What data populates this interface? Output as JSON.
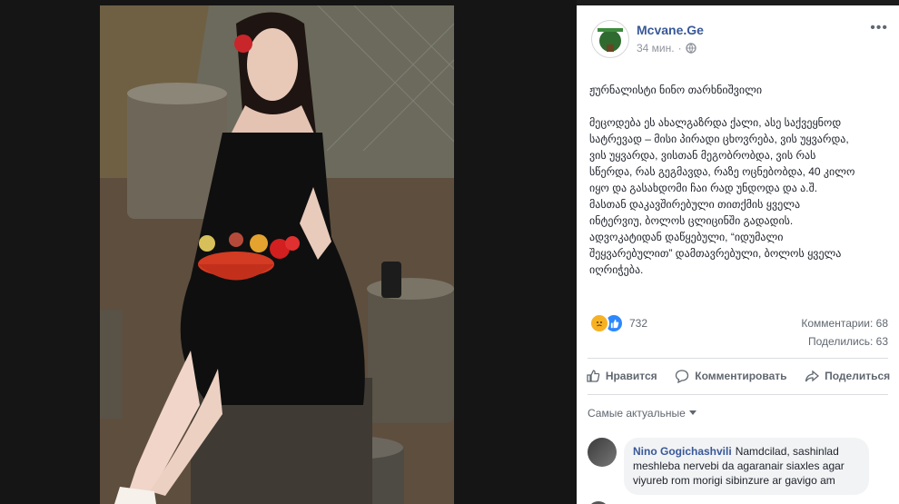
{
  "post": {
    "page_name": "Mcvane.Ge",
    "time": "34 мин.",
    "title_line": "ჟურნალისტი ნინო თარხნიშვილი",
    "body": "მეცოდება ეს ახალგაზრდა ქალი, ასე საქვეყნოდ\nსატრევად – მისი პირადი ცხოვრება, ვის უყვარდა,\nვის უყვარდა, ვისთან მეგობრობდა, ვის რას\nსწერდა, რას გეგმავდა, რაზე ოცნებობდა, 40 კილო\nიყო და გასახდომი ჩაი რად უნდოდა და ა.შ.\nმასთან დაკავშირებული თითქმის ყველა\nინტერვიუ, ბოლოს ცლიცინში გადადის.\nადვოკატიდან დაწყებული, “იდუმალი\nშეყვარებულით” დამთავრებული, ბოლოს ყველა\nიღრიჭება."
  },
  "reactions": {
    "count": "732"
  },
  "stats": {
    "comments": "Комментарии: 68",
    "shares": "Поделились: 63"
  },
  "actions": {
    "like": "Нравится",
    "comment": "Комментировать",
    "share": "Поделиться"
  },
  "comments_sort": "Самые актуальные",
  "comment": {
    "author": "Nino Gogichashvili",
    "text": "Namdcilad, sashinlad meshleba nervebi da agaranair siaxles agar viyureb rom morigi sibinzure ar gavigo am"
  },
  "colors": {
    "link": "#385898",
    "panel_bg": "#ffffff",
    "backdrop": "#1c1c1c"
  },
  "icons": [
    "more-icon",
    "globe-icon",
    "sad-reaction-icon",
    "like-reaction-icon",
    "like-icon",
    "comment-icon",
    "share-icon",
    "caret-down-icon"
  ]
}
